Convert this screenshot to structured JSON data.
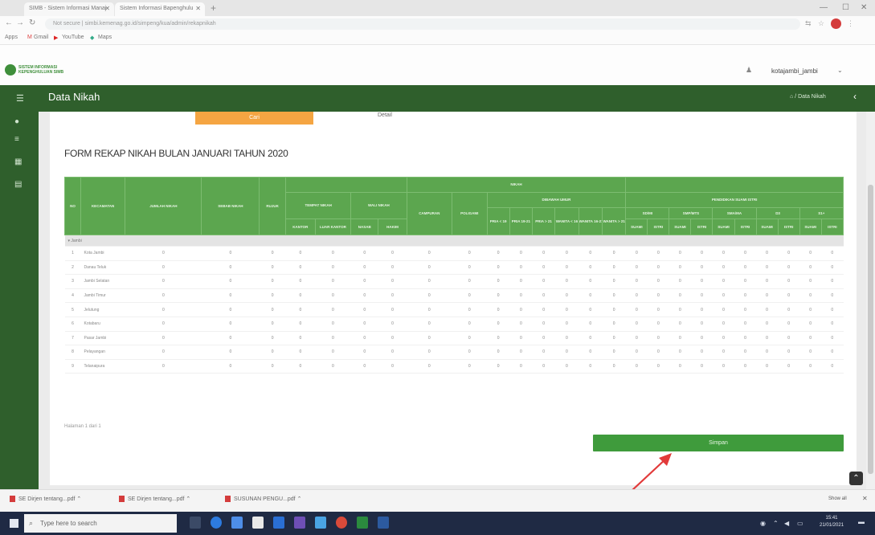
{
  "browser": {
    "tabs": [
      {
        "label": "SIMB - Sistem Informasi Manaj"
      },
      {
        "label": "Sistem Informasi Bapenghulu"
      }
    ],
    "url_prefix": "Not secure",
    "url": "simbi.kemenag.go.id/simpeng/kua/admin/rekapnikah",
    "bookmarks": [
      {
        "label": "Apps"
      },
      {
        "label": "Gmail"
      },
      {
        "label": "YouTube"
      },
      {
        "label": "Maps"
      }
    ]
  },
  "app": {
    "logo_text": "SISTEM INFORMASI KEPENGHULUAN SIMB",
    "username": "kotajambi_jambi",
    "page_title": "Data Nikah",
    "breadcrumb": "Data Nikah",
    "tab_primary": "Cari",
    "tab_detail": "Detail"
  },
  "form": {
    "title": "FORM REKAP NIKAH BULAN JANUARI TAHUN 2020",
    "headers": {
      "no": "NO",
      "kecamatan": "KECAMATAN",
      "jumlah_nikah": "JUMLAH NIKAH",
      "sebab_nikah": "SEBAB NIKAH",
      "rujuk": "RUJUK",
      "tempat_nikah": "TEMPAT NIKAH",
      "kantor": "KANTOR",
      "luar_kantor": "LUAR KANTOR",
      "wali_nikah": "WALI NIKAH",
      "nasab": "NASAB",
      "hakim": "HAKIM",
      "nikah": "NIKAH",
      "campuran": "CAMPURAN",
      "poligami": "POLIGAMI",
      "dibawah_umur": "DIBAWAH UMUR",
      "pria_lt_19": "PRIA < 19",
      "pria_19_21": "PRIA 19-21",
      "pria_gt_21": "PRIA > 21",
      "wanita_lt_16": "WANITA < 16",
      "wanita_16_21": "WANITA 16-21",
      "wanita_gt_21": "WANITA > 21",
      "pendidikan": "PENDIDIKAN SUAMI ISTRI",
      "edu_levels": [
        "SD/MI",
        "SMP/MTS",
        "SMA/MA",
        "D3",
        "S1+"
      ],
      "suami": "SUAMI",
      "istri": "ISTRI"
    },
    "group_label": "Jambi",
    "rows": [
      {
        "no": "1",
        "name": "Kota Jambi"
      },
      {
        "no": "2",
        "name": "Danau Teluk"
      },
      {
        "no": "3",
        "name": "Jambi Selatan"
      },
      {
        "no": "4",
        "name": "Jambi Timur"
      },
      {
        "no": "5",
        "name": "Jelutung"
      },
      {
        "no": "6",
        "name": "Kotabaru"
      },
      {
        "no": "7",
        "name": "Pasar Jambi"
      },
      {
        "no": "8",
        "name": "Pelayangan"
      },
      {
        "no": "9",
        "name": "Telanaipura"
      }
    ],
    "cell_value": "0",
    "pagination": "Halaman 1 dari 1",
    "save_label": "Simpan"
  },
  "downloads": [
    {
      "label": "SE Dirjen tentang...pdf"
    },
    {
      "label": "SE Dirjen tentang...pdf"
    },
    {
      "label": "SUSUNAN PENGU...pdf"
    }
  ],
  "downloads_showall": "Show all",
  "taskbar": {
    "search_placeholder": "Type here to search",
    "time": "15:41",
    "date": "21/01/2021"
  },
  "colors": {
    "header_green": "#2f5f2c",
    "table_header_green": "#5ca64f",
    "save_button": "#3f9b3c",
    "orange_button": "#f5a542",
    "annotation_arrow": "#e23a3a"
  }
}
